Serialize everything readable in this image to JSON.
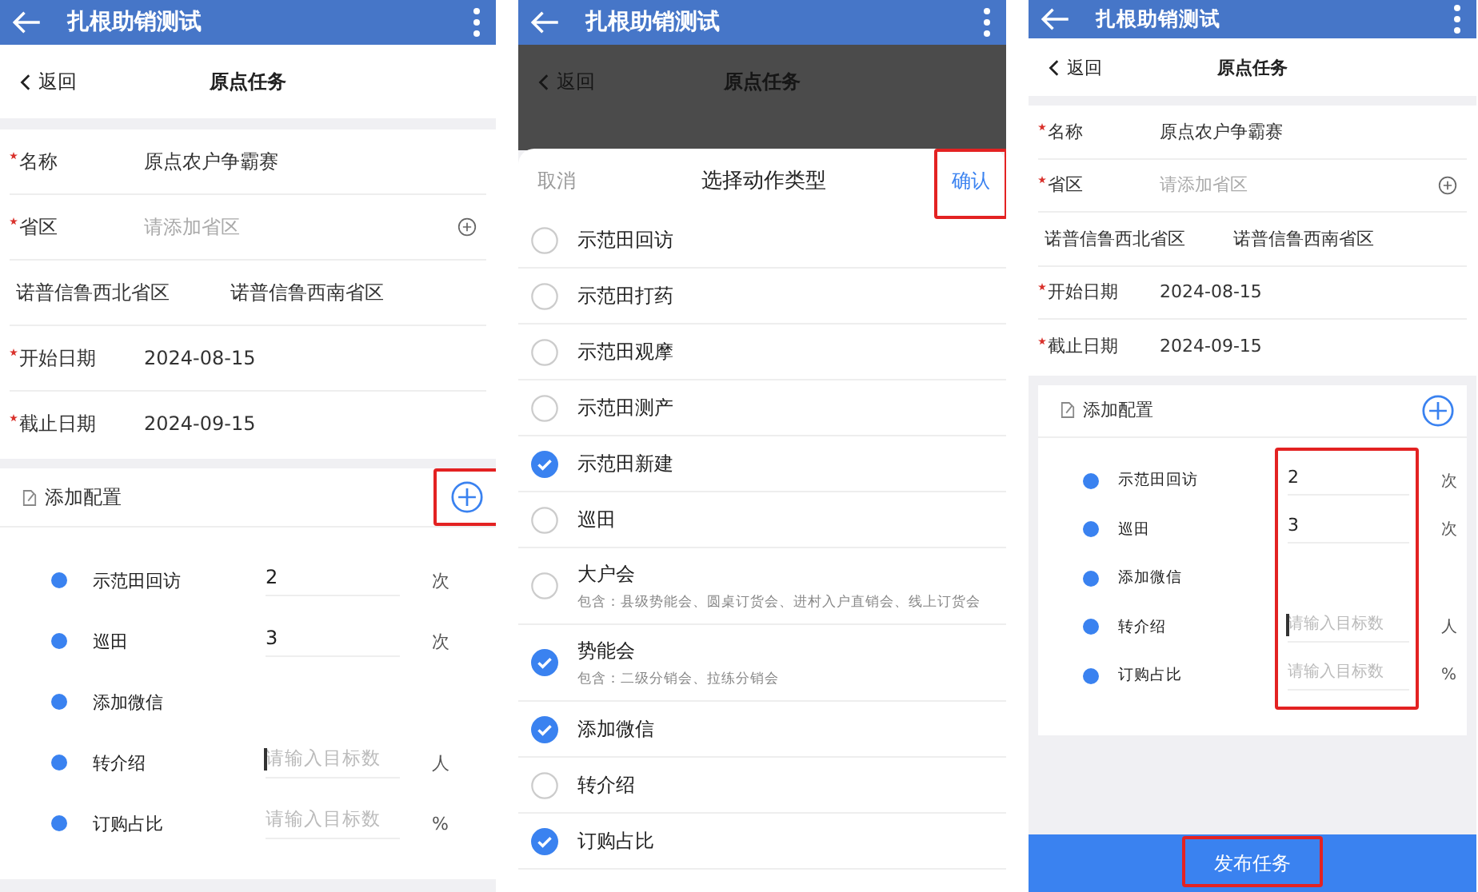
{
  "left_screen": {
    "app_bar": {
      "title": "扎根助销测试"
    },
    "nav": {
      "back": "返回",
      "title": "原点任务"
    },
    "fields": [
      {
        "kind": "text",
        "required": true,
        "label": "名称",
        "value": "原点农户争霸赛"
      },
      {
        "kind": "picker",
        "required": true,
        "label": "省区",
        "placeholder": "请添加省区"
      },
      {
        "kind": "tags",
        "tags": [
          "诺普信鲁西北省区",
          "诺普信鲁西南省区"
        ]
      },
      {
        "kind": "text",
        "required": true,
        "label": "开始日期",
        "value": "2024-08-15"
      },
      {
        "kind": "text",
        "required": true,
        "label": "截止日期",
        "value": "2024-09-15"
      }
    ],
    "config": {
      "title": "添加配置",
      "add_highlighted": true,
      "inputs_highlighted": false,
      "items": [
        {
          "kind": "input",
          "label": "示范田回访",
          "value": "2",
          "unit": "次",
          "focused": false
        },
        {
          "kind": "input",
          "label": "巡田",
          "value": "3",
          "unit": "次",
          "focused": false
        },
        {
          "kind": "plain",
          "label": "添加微信"
        },
        {
          "kind": "input",
          "label": "转介绍",
          "placeholder": "请输入目标数",
          "unit": "人",
          "focused": true
        },
        {
          "kind": "input",
          "label": "订购占比",
          "placeholder": "请输入目标数",
          "unit": "%",
          "focused": false
        }
      ]
    }
  },
  "middle_screen": {
    "app_bar": {
      "title": "扎根助销测试"
    },
    "nav": {
      "back": "返回",
      "title": "原点任务"
    },
    "sheet": {
      "cancel": "取消",
      "title": "选择动作类型",
      "confirm": "确认",
      "confirm_highlighted": true,
      "options": [
        {
          "label": "示范田回访",
          "checked": false
        },
        {
          "label": "示范田打药",
          "checked": false
        },
        {
          "label": "示范田观摩",
          "checked": false
        },
        {
          "label": "示范田测产",
          "checked": false
        },
        {
          "label": "示范田新建",
          "checked": true
        },
        {
          "label": "巡田",
          "checked": false
        },
        {
          "label": "大户会",
          "note": "包含：县级势能会、圆桌订货会、进村入户直销会、线上订货会",
          "checked": false
        },
        {
          "label": "势能会",
          "note": "包含：二级分销会、拉练分销会",
          "checked": true
        },
        {
          "label": "添加微信",
          "checked": true
        },
        {
          "label": "转介绍",
          "checked": false
        },
        {
          "label": "订购占比",
          "checked": true
        }
      ]
    }
  },
  "right_screen": {
    "app_bar": {
      "title": "扎根助销测试"
    },
    "nav": {
      "back": "返回",
      "title": "原点任务"
    },
    "fields": [
      {
        "kind": "text",
        "required": true,
        "label": "名称",
        "value": "原点农户争霸赛"
      },
      {
        "kind": "picker",
        "required": true,
        "label": "省区",
        "placeholder": "请添加省区"
      },
      {
        "kind": "tags",
        "tags": [
          "诺普信鲁西北省区",
          "诺普信鲁西南省区"
        ]
      },
      {
        "kind": "text",
        "required": true,
        "label": "开始日期",
        "value": "2024-08-15"
      },
      {
        "kind": "text",
        "required": true,
        "label": "截止日期",
        "value": "2024-09-15"
      }
    ],
    "config": {
      "title": "添加配置",
      "add_highlighted": false,
      "inputs_highlighted": true,
      "items": [
        {
          "kind": "input",
          "label": "示范田回访",
          "value": "2",
          "unit": "次",
          "focused": false
        },
        {
          "kind": "input",
          "label": "巡田",
          "value": "3",
          "unit": "次",
          "focused": false
        },
        {
          "kind": "plain",
          "label": "添加微信"
        },
        {
          "kind": "input",
          "label": "转介绍",
          "placeholder": "请输入目标数",
          "unit": "人",
          "focused": true
        },
        {
          "kind": "input",
          "label": "订购占比",
          "placeholder": "请输入目标数",
          "unit": "%",
          "focused": false
        }
      ]
    },
    "publish": {
      "label": "发布任务",
      "highlighted": true
    }
  }
}
